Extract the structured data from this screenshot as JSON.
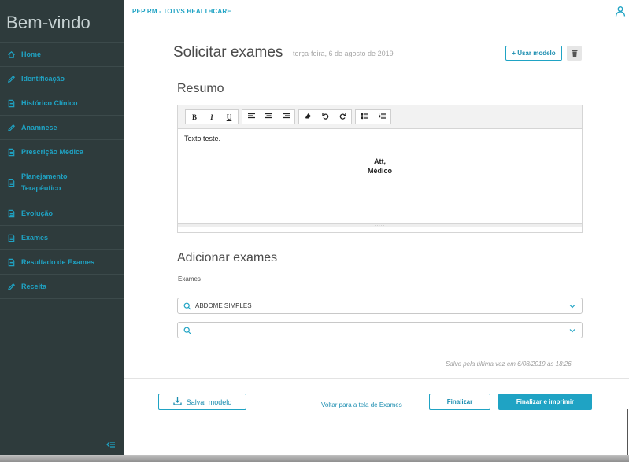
{
  "sidebar": {
    "title": "Bem-vindo",
    "items": [
      {
        "label": "Home",
        "icon": "home-icon"
      },
      {
        "label": "Identificação",
        "icon": "pencil-icon"
      },
      {
        "label": "Histórico Clínico",
        "icon": "document-icon"
      },
      {
        "label": "Anamnese",
        "icon": "pencil-icon"
      },
      {
        "label": "Prescrição Médica",
        "icon": "document-icon"
      },
      {
        "label": "Planejamento Terapêutico",
        "icon": "document-icon"
      },
      {
        "label": "Evolução",
        "icon": "document-icon"
      },
      {
        "label": "Exames",
        "icon": "document-icon"
      },
      {
        "label": "Resultado de Exames",
        "icon": "document-icon"
      },
      {
        "label": "Receita",
        "icon": "pencil-icon"
      }
    ]
  },
  "header": {
    "breadcrumb": "PEP RM - TOTVS HEALTHCARE",
    "title": "Solicitar exames",
    "date": "terça-feira, 6 de agosto de 2019",
    "use_model_label": "+ Usar modelo"
  },
  "summary": {
    "title": "Resumo",
    "text": "Texto teste.",
    "signature_line1": "Att,",
    "signature_line2": "Médico",
    "toolbar": [
      "bold",
      "italic",
      "underline",
      "align-left",
      "align-center",
      "align-right",
      "eraser",
      "undo",
      "redo",
      "bullet-list",
      "numbered-list"
    ]
  },
  "exams": {
    "title": "Adicionar exames",
    "field_label": "Exames",
    "selected_1": "ABDOME SIMPLES",
    "selected_2": ""
  },
  "footer": {
    "saved_text": "Salvo pela última vez em 6/08/2019 às 18:26.",
    "save_model_label": "Salvar modelo",
    "back_link": "Voltar para a tela de Exames",
    "finalize_label": "Finalizar",
    "finalize_print_label": "Finalizar e imprimir"
  },
  "colors": {
    "accent": "#1fa3c4",
    "sidebar_bg": "#2e3b3c"
  }
}
